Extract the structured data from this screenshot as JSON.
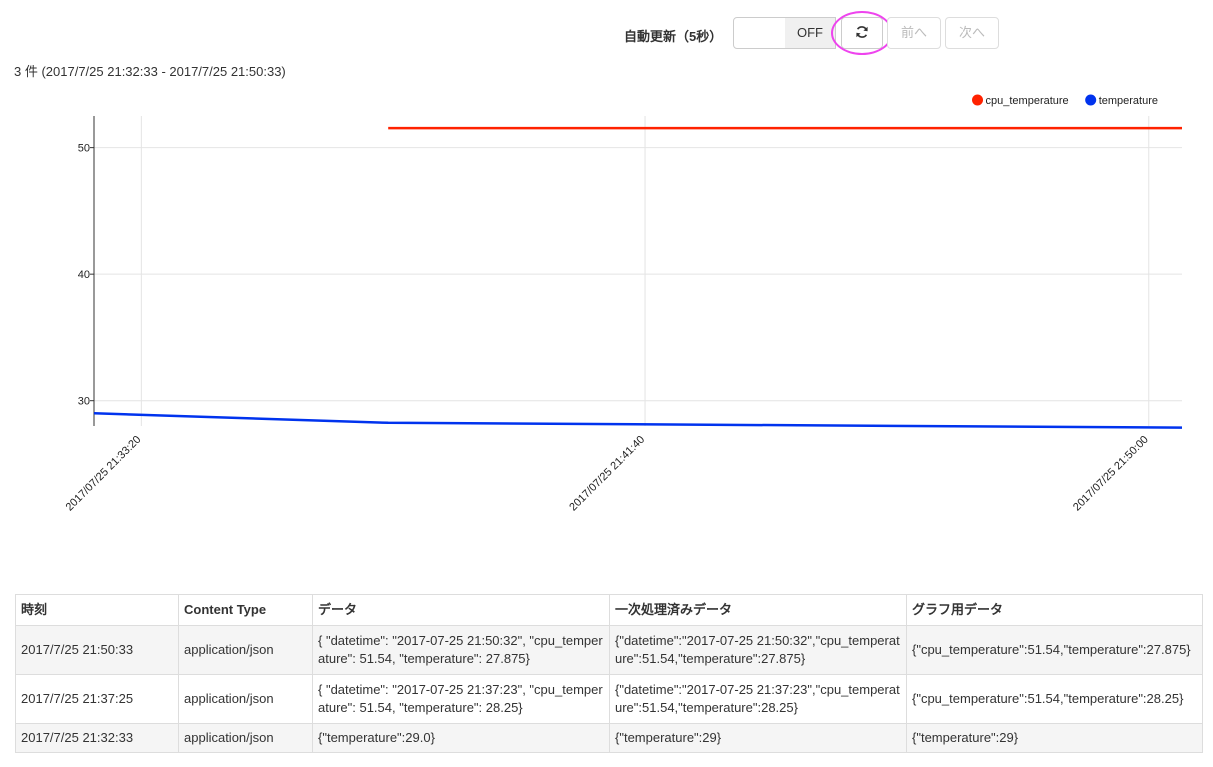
{
  "toolbar": {
    "auto_refresh_label": "自動更新（5秒）",
    "toggle_state": "OFF",
    "refresh_icon": "refresh-icon",
    "prev_label": "前へ",
    "next_label": "次へ"
  },
  "summary": "3 件 (2017/7/25 21:32:33 - 2017/7/25 21:50:33)",
  "colors": {
    "cpu_temperature": "#ff2200",
    "temperature": "#0033ee",
    "highlight": "#ee44ee"
  },
  "chart_data": {
    "type": "line",
    "x_range": [
      "2017/07/25 21:32:33",
      "2017/07/25 21:50:33"
    ],
    "ylim": [
      28,
      52.5
    ],
    "y_ticks": [
      "50",
      "40",
      "30"
    ],
    "x_ticks": [
      "2017/07/25 21:33:20",
      "2017/07/25 21:41:40",
      "2017/07/25 21:50:00"
    ],
    "grid": true,
    "legend_position": "top-right",
    "series": [
      {
        "name": "cpu_temperature",
        "points": [
          {
            "x": "2017/07/25 21:37:25",
            "y": 51.54
          },
          {
            "x": "2017/07/25 21:50:33",
            "y": 51.54
          }
        ]
      },
      {
        "name": "temperature",
        "points": [
          {
            "x": "2017/07/25 21:32:33",
            "y": 29.0
          },
          {
            "x": "2017/07/25 21:37:25",
            "y": 28.25
          },
          {
            "x": "2017/07/25 21:50:33",
            "y": 27.875
          }
        ]
      }
    ]
  },
  "table": {
    "headers": [
      "時刻",
      "Content Type",
      "データ",
      "一次処理済みデータ",
      "グラフ用データ"
    ],
    "rows": [
      [
        "2017/7/25 21:50:33",
        "application/json",
        "{ \"datetime\": \"2017-07-25 21:50:32\", \"cpu_temperature\": 51.54, \"temperature\": 27.875}",
        "{\"datetime\":\"2017-07-25 21:50:32\",\"cpu_temperature\":51.54,\"temperature\":27.875}",
        "{\"cpu_temperature\":51.54,\"temperature\":27.875}"
      ],
      [
        "2017/7/25 21:37:25",
        "application/json",
        "{ \"datetime\": \"2017-07-25 21:37:23\", \"cpu_temperature\": 51.54, \"temperature\": 28.25}",
        "{\"datetime\":\"2017-07-25 21:37:23\",\"cpu_temperature\":51.54,\"temperature\":28.25}",
        "{\"cpu_temperature\":51.54,\"temperature\":28.25}"
      ],
      [
        "2017/7/25 21:32:33",
        "application/json",
        "{\"temperature\":29.0}",
        "{\"temperature\":29}",
        "{\"temperature\":29}"
      ]
    ]
  }
}
